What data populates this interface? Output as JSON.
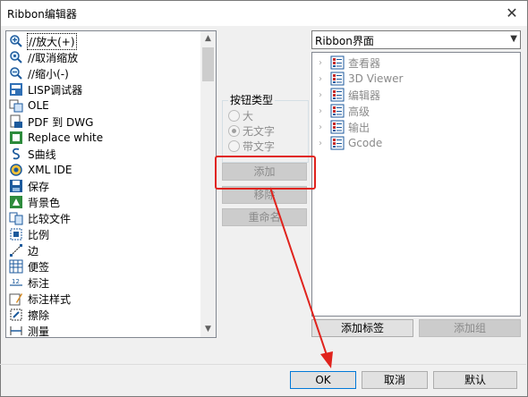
{
  "window": {
    "title": "Ribbon编辑器",
    "close_glyph": "✕"
  },
  "command_list": {
    "items": [
      {
        "label": "//放大(+)",
        "icon": "zoom-in-icon",
        "selected": true
      },
      {
        "label": "//取消缩放",
        "icon": "zoom-reset-icon"
      },
      {
        "label": "//缩小(-)",
        "icon": "zoom-out-icon"
      },
      {
        "label": "LISP调试器",
        "icon": "lisp-debugger-icon"
      },
      {
        "label": "OLE",
        "icon": "ole-icon"
      },
      {
        "label": "PDF 到 DWG",
        "icon": "pdf-to-dwg-icon"
      },
      {
        "label": "Replace white",
        "icon": "replace-white-icon"
      },
      {
        "label": "S曲线",
        "icon": "s-curve-icon"
      },
      {
        "label": "XML IDE",
        "icon": "xml-ide-icon"
      },
      {
        "label": "保存",
        "icon": "save-icon"
      },
      {
        "label": "背景色",
        "icon": "background-color-icon"
      },
      {
        "label": "比较文件",
        "icon": "compare-files-icon"
      },
      {
        "label": "比例",
        "icon": "scale-icon"
      },
      {
        "label": "边",
        "icon": "edge-icon"
      },
      {
        "label": "便签",
        "icon": "note-icon"
      },
      {
        "label": "标注",
        "icon": "dimension-icon"
      },
      {
        "label": "标注样式",
        "icon": "dimension-style-icon"
      },
      {
        "label": "擦除",
        "icon": "erase-icon"
      },
      {
        "label": "测量",
        "icon": "measure-icon"
      }
    ]
  },
  "button_type": {
    "title": "按钮类型",
    "options": [
      {
        "label": "大",
        "checked": false
      },
      {
        "label": "无文字",
        "checked": true
      },
      {
        "label": "带文字",
        "checked": false
      }
    ]
  },
  "middle_buttons": {
    "add": "添加",
    "rename_move": "移除",
    "rename": "重命名"
  },
  "ribbon": {
    "combo_value": "Ribbon界面",
    "tree": [
      {
        "label": "查看器",
        "icon": "panel-icon"
      },
      {
        "label": "3D Viewer",
        "icon": "panel-icon"
      },
      {
        "label": "编辑器",
        "icon": "panel-icon"
      },
      {
        "label": "高级",
        "icon": "panel-icon"
      },
      {
        "label": "输出",
        "icon": "panel-icon"
      },
      {
        "label": "Gcode",
        "icon": "panel-icon"
      }
    ],
    "add_tab": "添加标签",
    "add_group": "添加组"
  },
  "footer": {
    "ok": "OK",
    "cancel": "取消",
    "default": "默认"
  },
  "colors": {
    "highlight_red": "#e0231d",
    "focus_blue": "#0078d7"
  }
}
